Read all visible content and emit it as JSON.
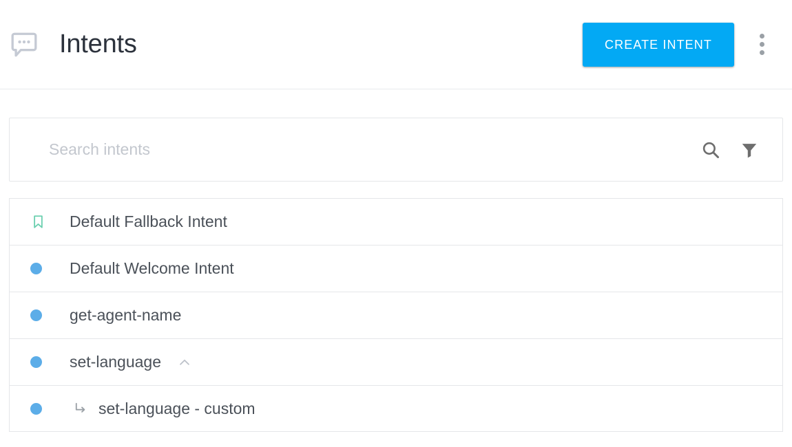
{
  "header": {
    "title": "Intents",
    "title_icon": "chat-bubble-dots-icon",
    "create_button_label": "CREATE INTENT",
    "overflow_menu_icon": "kebab-menu-icon",
    "accent_color": "#03A9F4"
  },
  "search": {
    "placeholder": "Search intents",
    "value": "",
    "search_icon": "search-icon",
    "filter_icon": "filter-funnel-icon"
  },
  "intents": [
    {
      "label": "Default Fallback Intent",
      "marker": "bookmark-icon",
      "marker_color": "#6BCFAF",
      "child": false,
      "expandable": false
    },
    {
      "label": "Default Welcome Intent",
      "marker": "blue-dot-icon",
      "marker_color": "#5CADE8",
      "child": false,
      "expandable": false
    },
    {
      "label": "get-agent-name",
      "marker": "blue-dot-icon",
      "marker_color": "#5CADE8",
      "child": false,
      "expandable": false
    },
    {
      "label": "set-language",
      "marker": "blue-dot-icon",
      "marker_color": "#5CADE8",
      "child": false,
      "expandable": true,
      "expand_icon": "chevron-up-icon"
    },
    {
      "label": "set-language - custom",
      "marker": "blue-dot-icon",
      "marker_color": "#5CADE8",
      "child": true,
      "child_icon": "subdirectory-arrow-right-icon",
      "expandable": false
    }
  ]
}
